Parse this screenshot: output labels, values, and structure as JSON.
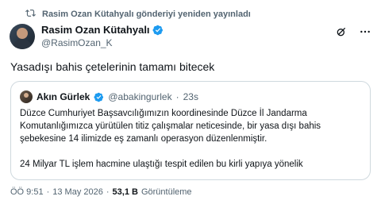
{
  "repost": {
    "icon": "repost-icon",
    "text": "Rasim Ozan Kütahyalı gönderiyi yeniden yayınladı"
  },
  "author": {
    "name": "Rasim Ozan Kütahyalı",
    "handle": "@RasimOzan_K",
    "verified": true
  },
  "actions": {
    "icons": [
      "grok-icon",
      "more-icon"
    ]
  },
  "tweet": {
    "text": "Yasadışı bahis çetelerinin tamamı bitecek"
  },
  "quote": {
    "name": "Akın Gürlek",
    "handle": "@abakingurlek",
    "separator": "·",
    "time": "23s",
    "paragraph1": "Düzce Cumhuriyet Başsavcılığımızın koordinesinde Düzce İl Jandarma Komutanlığımızca yürütülen titiz çalışmalar neticesinde, bir yasa dışı bahis şebekesine 14 ilimizde eş zamanlı operasyon düzenlenmiştir.",
    "paragraph2": "24 Milyar TL işlem hacmine ulaştığı tespit edilen bu kirli yapıya yönelik"
  },
  "meta": {
    "time": "ÖÖ 9:51",
    "dot1": "·",
    "date": "13 May 2026",
    "dot2": "·",
    "views": "53,1 B",
    "views_label": "Görüntüleme"
  },
  "colors": {
    "verified": "#1d9bf0",
    "secondary_text": "#536471",
    "border": "#cfd9de"
  }
}
